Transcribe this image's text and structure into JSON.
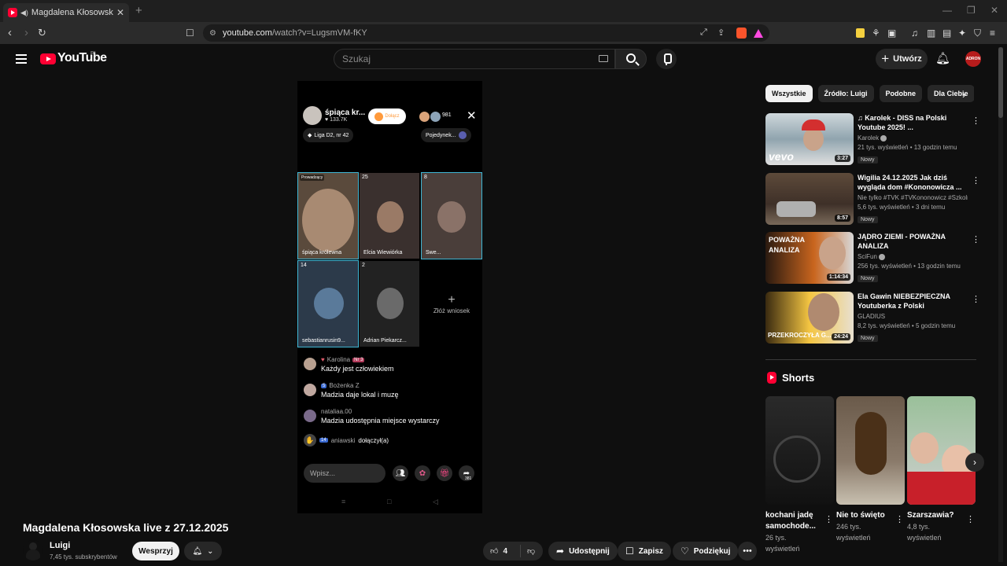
{
  "browser": {
    "tab_title": "Magdalena Kłosowska live z 2",
    "new_tab": "+",
    "url_host": "youtube.com",
    "url_path": "/watch?v=LugsmVM-fKY"
  },
  "yt": {
    "logo_text": "YouTube",
    "country_code": "PL",
    "search_placeholder": "Szukaj",
    "create_label": "Utwórz",
    "avatar_text": "ADRON"
  },
  "player": {
    "host_name": "śpiąca kr...",
    "host_likes": "♥ 133.7K",
    "join_label": "Dołącz",
    "viewer_count": "981",
    "league": "Liga D2, nr 42",
    "duel": "Pojedynek...",
    "cells": [
      {
        "tag": "Prowadzący",
        "label": "śpiąca królewna"
      },
      {
        "tag": "25",
        "label": "Elcia Wiewiórka"
      },
      {
        "tag": "8",
        "label": "Swe..."
      },
      {
        "tag": "14",
        "label": "sebastianrusin9..."
      },
      {
        "tag": "2",
        "label": "Adrian Piekarcz..."
      }
    ],
    "add_request": "Złóż wniosek",
    "chat": [
      {
        "user": "Karolina",
        "badge": "Nr 3",
        "text": "Każdy jest człowiekiem"
      },
      {
        "user": "Bożenka Z",
        "badge": "5",
        "text": "Madzia daje lokal i muzę"
      },
      {
        "user": "nataliaa.00",
        "badge": "",
        "text": "Madzia udostępnia miejsce wystarczy"
      }
    ],
    "join_event_badge": "14",
    "join_event_user": "aniawski",
    "join_event_text": "dołączył(a)",
    "input_placeholder": "Wpisz...",
    "share_count": "381"
  },
  "video": {
    "title": "Magdalena Kłosowska live z 27.12.2025",
    "channel": "Luigi",
    "subscribers": "7,45 tys. subskrybentów",
    "support_label": "Wesprzyj",
    "likes": "4",
    "share_label": "Udostępnij",
    "save_label": "Zapisz",
    "thanks_label": "Podziękuj"
  },
  "sidebar": {
    "chips": [
      "Wszystkie",
      "Źródło: Luigi",
      "Podobne",
      "Dla Ciebie"
    ],
    "recs": [
      {
        "title": "♫ Karolek - DISS na Polski Youtube 2025! ...",
        "channel": "Karolek",
        "meta": "21 tys. wyświetleń • 13 godzin temu",
        "badge": "Nowy",
        "duration": "3:27",
        "thumb_text": "vevo"
      },
      {
        "title": "Wigilia 24.12.2025 Jak dziś wygląda dom #Kononowicza ...",
        "channel": "Nie tylko #TVK #TVKononowicz #Szkoln...",
        "meta": "5,6 tys. wyświetleń • 3 dni temu",
        "badge": "Nowy",
        "duration": "8:57",
        "thumb_text": ""
      },
      {
        "title": "JĄDRO ZIEMI - POWAŻNA ANALIZA",
        "channel": "SciFun",
        "meta": "256 tys. wyświetleń • 13 godzin temu",
        "badge": "Nowy",
        "duration": "1:14:34",
        "thumb_text": "POWAŻNA ANALIZA"
      },
      {
        "title": "Ela Gawin NIEBEZPIECZNA Youtuberka z Polski",
        "channel": "GLADIUS",
        "meta": "8,2 tys. wyświetleń • 5 godzin temu",
        "badge": "Nowy",
        "duration": "24:24",
        "thumb_text": "PRZEKROCZYŁA G..."
      }
    ],
    "shorts_title": "Shorts",
    "shorts": [
      {
        "title": "kochani jadę samochode...",
        "views": "26 tys. wyświetleń"
      },
      {
        "title": "Nie to święto",
        "views": "246 tys. wyświetleń"
      },
      {
        "title": "Szarszawia?",
        "views": "4,8 tys. wyświetleń"
      }
    ]
  },
  "colors": {
    "yt_red": "#ff0033",
    "highlight_cyan": "#3fb6d4",
    "background": "#0f0f0f"
  }
}
